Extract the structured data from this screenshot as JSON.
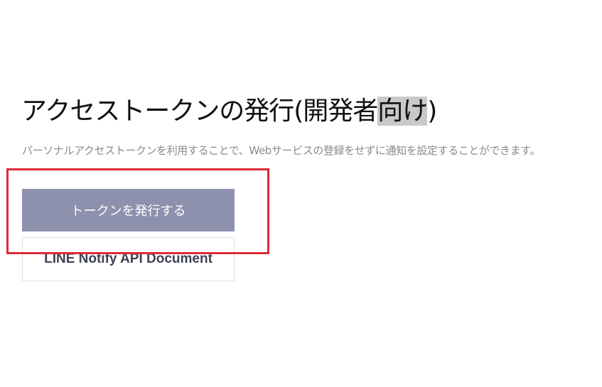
{
  "header": {
    "title_main": "アクセストークンの発行(開発者",
    "title_highlight": "向け",
    "title_end": ")",
    "description": "パーソナルアクセストークンを利用することで、Webサービスの登録をせずに通知を設定することができます。"
  },
  "actions": {
    "issue_token_label": "トークンを発行する",
    "api_document_label": "LINE Notify API Document"
  },
  "colors": {
    "primary_button": "#8d91ad",
    "annotation_box": "#de2a36",
    "title_highlight": "#c9c9c9"
  }
}
